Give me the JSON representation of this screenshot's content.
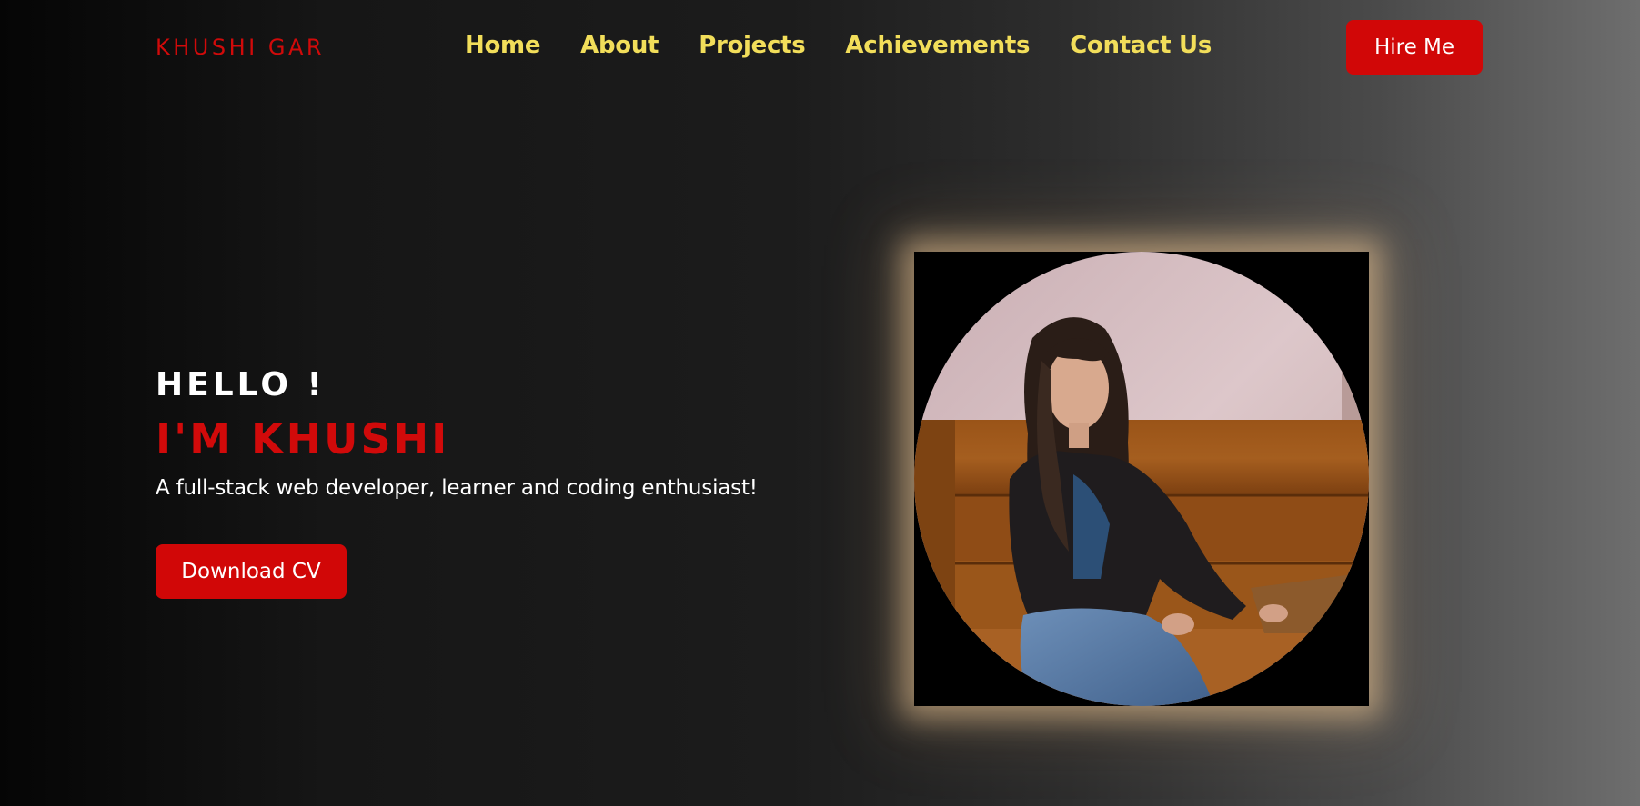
{
  "navbar": {
    "brand": "KHUSHI GAR",
    "links": [
      {
        "label": "Home"
      },
      {
        "label": "About"
      },
      {
        "label": "Projects"
      },
      {
        "label": "Achievements"
      },
      {
        "label": "Contact Us"
      }
    ],
    "hire_button": "Hire Me"
  },
  "hero": {
    "greeting": "HELLO !",
    "name": "I'M KHUSHI",
    "tagline": "A full-stack web developer, learner and coding enthusiast!",
    "download_button": "Download CV",
    "photo": "profile-photo"
  },
  "colors": {
    "accent_red": "#d10707",
    "nav_yellow": "#f2de5a",
    "text_white": "#ffffff",
    "glow": "#ecc696"
  }
}
